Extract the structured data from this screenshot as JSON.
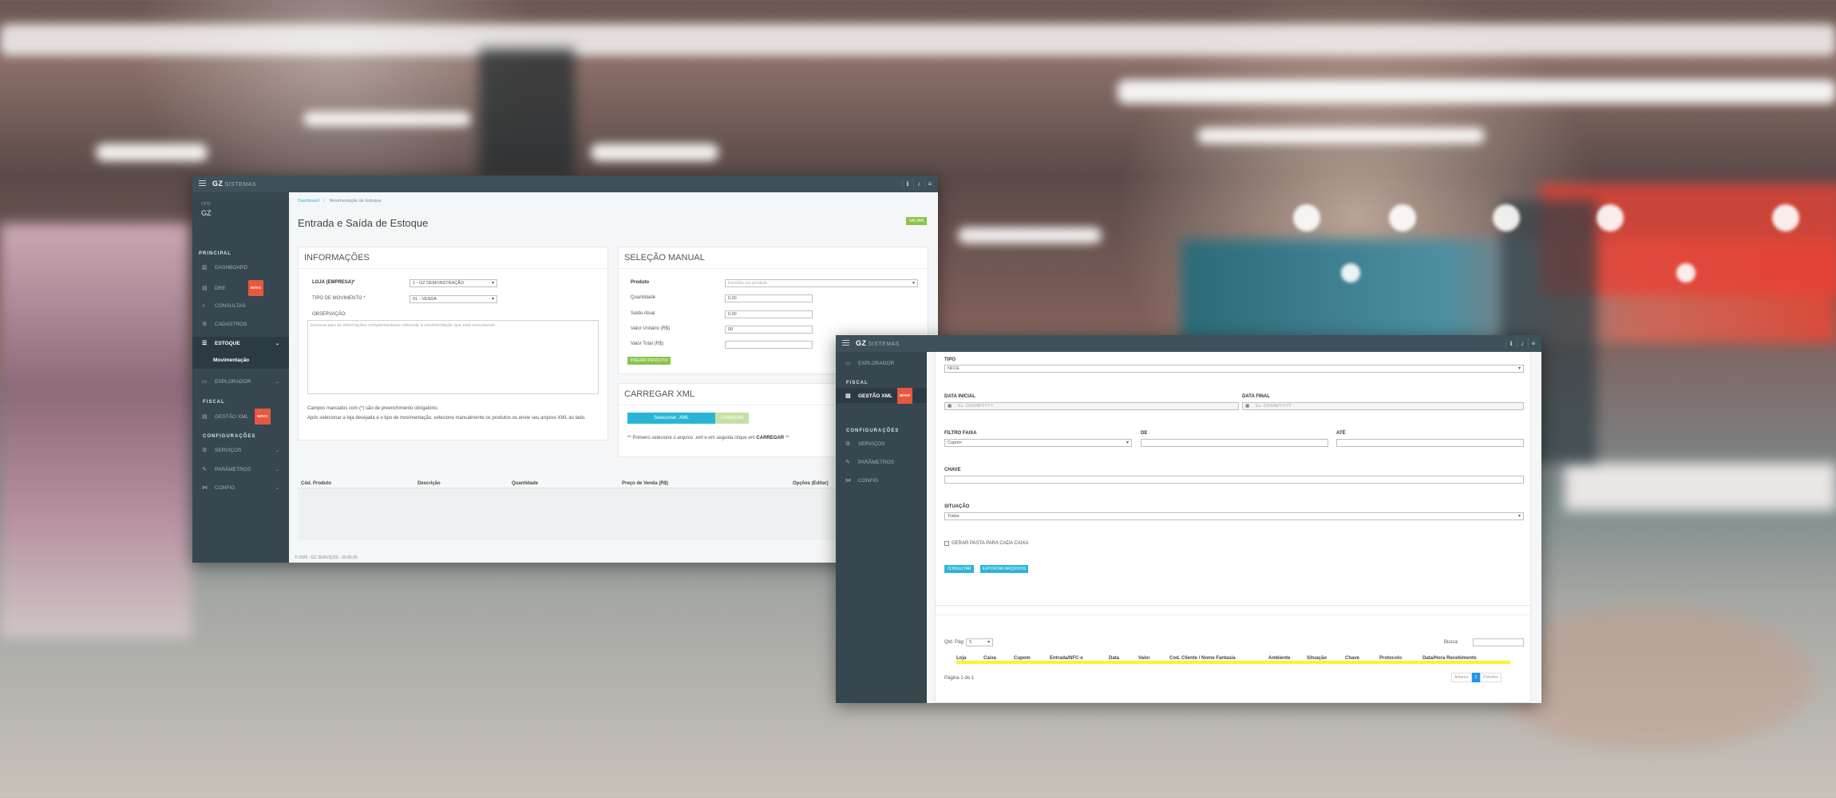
{
  "background": {
    "description_colors": {
      "accent": "#8bc34a",
      "info": "#29b6d6",
      "danger": "#e8573f",
      "sidebar": "#364750"
    }
  },
  "win1": {
    "brand": "GZ",
    "brand_sub": "SISTEMAS",
    "user_role": "CPD",
    "user_name": "GZ",
    "sections": {
      "principal": "PRINCIPAL",
      "fiscal": "FISCAL",
      "config": "CONFIGURAÇÕES"
    },
    "menu": {
      "dashboard": "DASHBOARD",
      "dre": "DRE",
      "consultas": "CONSULTAS",
      "cadastros": "CADASTROS",
      "estoque": "ESTOQUE",
      "movimentacao": "Movimentação",
      "explorador": "EXPLORADOR",
      "gestao_xml": "GESTÃO XML",
      "servicos": "SERVIÇOS",
      "parametros": "PARÂMETROS",
      "config": "CONFIG"
    },
    "badge_novo": "NOVO",
    "breadcrumb": {
      "home": "Dashboard",
      "current": "Movimentação de Estoque"
    },
    "page_title": "Entrada e Saída de Estoque",
    "save_button": "SALVAR",
    "info_panel": {
      "title": "INFORMAÇÕES",
      "loja_label": "LOJA (EMPRESA)*",
      "loja_value": "1 - GZ DEMONSTRAÇÃO",
      "tipo_label": "TIPO DE MOVIMENTO *",
      "tipo_value": "01 - VENDA",
      "obs_label": "OBSERVAÇÃO:",
      "obs_placeholder": "Escreva aqui as informações complementares referente à movimentação que está executando.",
      "note1": "Campos marcados com (*) são de preenchimento obrigatório.",
      "note2": "Após selecionar a loja desejada e o tipo de movimentação, selecione manualmente os produtos ou envie seu arquivo XML ao lado."
    },
    "manual_panel": {
      "title": "SELEÇÃO MANUAL",
      "produto_label": "Produto",
      "produto_placeholder": "Escolha um produto",
      "quantidade_label": "Quantidade",
      "quantidade_value": "0,00",
      "saldo_label": "Saldo Atual",
      "saldo_value": "0,00",
      "valor_unit_label": "Valor Unitário (R$)",
      "valor_unit_value": "00",
      "valor_total_label": "Valor Total (R$)",
      "valor_total_value": "",
      "add_button": "INSERIR PRODUTO"
    },
    "xml_panel": {
      "title": "CARREGAR XML",
      "select_button": "Selecionar .XML",
      "load_button": "CARREGAR",
      "hint_prefix": "** Primeiro selecione o arquivo .xml e em seguida clique em ",
      "hint_bold": "CARREGAR",
      "hint_suffix": " **"
    },
    "table_headers": [
      "Cód. Produto",
      "Descrição",
      "Quantidade",
      "Preço de Venda (R$)",
      "Opções (Editar)"
    ],
    "footer": "© 2020 - GZ SERVIÇOS - 20.06.00"
  },
  "win2": {
    "brand": "GZ",
    "brand_sub": "SISTEMAS",
    "menu": {
      "explorador": "EXPLORADOR",
      "fiscal": "FISCAL",
      "gestao_xml": "GESTÃO XML",
      "config_section": "CONFIGURAÇÕES",
      "servicos": "SERVIÇOS",
      "parametros": "PARÂMETROS",
      "config": "CONFIG"
    },
    "badge_novo": "NOVO",
    "form": {
      "tipo_label": "TIPO",
      "tipo_value": "NFCE",
      "data_inicial_label": "DATA INICIAL",
      "data_final_label": "DATA FINAL",
      "date_placeholder": "Ex: DD/MM/YYYY",
      "filtro_label": "FILTRO FAIXA",
      "filtro_value": "Cupom",
      "de_label": "DE",
      "ate_label": "ATÉ",
      "chave_label": "CHAVE",
      "situacao_label": "SITUAÇÃO",
      "situacao_value": "Todos",
      "checkbox_label": "GERAR PASTA PARA CADA CAIXA",
      "consultar_button": "CONSULTAR",
      "exportar_button": "EXPORTAR ARQUIVOS"
    },
    "results": {
      "qtd_label": "Qtd. Pág:",
      "qtd_value": "5",
      "busca_label": "Busca:",
      "headers": [
        "Loja",
        "Caixa",
        "Cupom",
        "Entrada/NFC-e",
        "Data",
        "Valor",
        "Cod. Cliente / Nome Fantasia",
        "Ambiente",
        "Situação",
        "Chave",
        "Protocolo",
        "Data/Hora Recebimento"
      ],
      "page_info": "Página 1 de 1",
      "prev": "Anterior",
      "page": "1",
      "next": "Próximo"
    }
  }
}
